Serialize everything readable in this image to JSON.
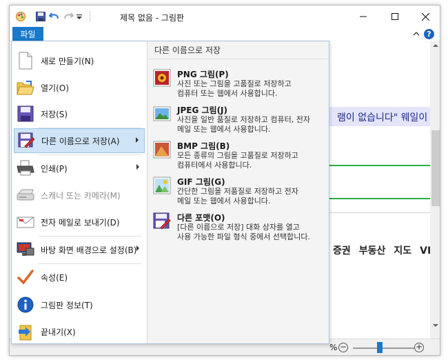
{
  "titlebar": {
    "title": "제목 없음 - 그림판",
    "qat": [
      {
        "name": "paint-app-icon"
      },
      {
        "name": "save-icon"
      },
      {
        "name": "undo-icon"
      },
      {
        "name": "redo-icon"
      },
      {
        "name": "customize-qat-icon"
      }
    ],
    "window_buttons": [
      "minimize",
      "maximize",
      "close"
    ]
  },
  "ribbon": {
    "file_tab_label": "파일",
    "help_label": "?"
  },
  "file_menu": {
    "items": [
      {
        "label": "새로 만들기(N)",
        "icon": "new-file-icon",
        "enabled": true,
        "has_submenu": false
      },
      {
        "label": "열기(O)",
        "icon": "open-folder-icon",
        "enabled": true,
        "has_submenu": false
      },
      {
        "label": "저장(S)",
        "icon": "save-disk-icon",
        "enabled": true,
        "has_submenu": false
      },
      {
        "label": "다른 이름으로 저장(A)",
        "icon": "save-as-icon",
        "enabled": true,
        "has_submenu": true,
        "selected": true
      },
      {
        "label": "인쇄(P)",
        "icon": "printer-icon",
        "enabled": true,
        "has_submenu": true
      },
      {
        "label": "스캐너 또는 카메라(M)",
        "icon": "scanner-icon",
        "enabled": false,
        "has_submenu": false
      },
      {
        "label": "전자 메일로 보내기(D)",
        "icon": "email-icon",
        "enabled": true,
        "has_submenu": false
      },
      {
        "label": "바탕 화면 배경으로 설정(B)",
        "icon": "desktop-background-icon",
        "enabled": true,
        "has_submenu": true
      },
      {
        "label": "속성(E)",
        "icon": "checkmark-icon",
        "enabled": true,
        "has_submenu": false
      },
      {
        "label": "그림판 정보(T)",
        "icon": "info-icon",
        "enabled": true,
        "has_submenu": false
      },
      {
        "label": "끝내기(X)",
        "icon": "exit-icon",
        "enabled": true,
        "has_submenu": false
      }
    ]
  },
  "save_as_submenu": {
    "header": "다른 이름으로 저장",
    "items": [
      {
        "title": "PNG 그림(P)",
        "desc": "사진 또는 그림을 고품질로 저장하고\n컴퓨터 또는 웹에서 사용합니다.",
        "icon": "png-picture-icon"
      },
      {
        "title": "JPEG 그림(J)",
        "desc": "사진을 일반 품질로 저장하고 컴퓨터, 전자\n메일 또는 웹에서 사용합니다.",
        "icon": "jpeg-picture-icon"
      },
      {
        "title": "BMP 그림(B)",
        "desc": "모든 종류의 그림을 고품질로 저장하고\n컴퓨터에서 사용합니다.",
        "icon": "bmp-picture-icon"
      },
      {
        "title": "GIF 그림(G)",
        "desc": "간단한 그림을 저품질로 저장하고 전자\n메일 또는 웹에서 사용합니다.",
        "icon": "gif-picture-icon"
      },
      {
        "title": "다른 포맷(O)",
        "desc": "[다른 이름으로 저장] 대화 상자를 열고\n사용 가능한 파일 형식 중에서 선택합니다.",
        "icon": "other-format-icon"
      }
    ]
  },
  "canvas": {
    "banner_text": "램이 없습니다\" 웨일이",
    "nav_words": [
      "증권",
      "부동산",
      "지도",
      "VII"
    ]
  },
  "statusbar": {
    "zoom_suffix": "%",
    "zoom_out_label": "−",
    "zoom_in_label": "+"
  },
  "colors": {
    "accent": "#1979ca",
    "selected_bg": "#cfe4f7",
    "banner_bg": "#e4e4fb",
    "green_line": "#27ad41"
  }
}
